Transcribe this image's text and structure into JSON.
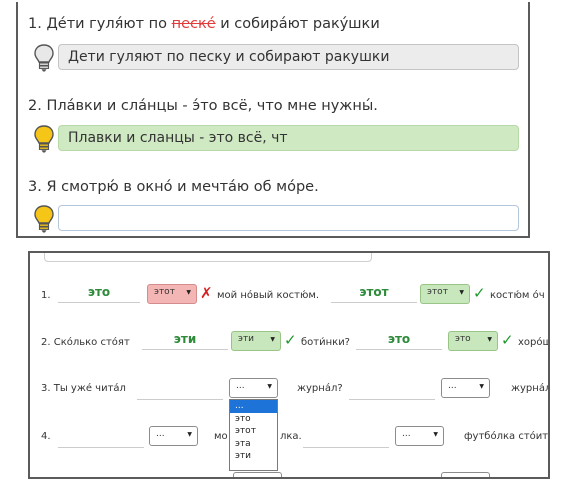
{
  "exercise1": {
    "items": [
      {
        "prefix": "1. Дéти гуля́ют по ",
        "error_word": "пескé",
        "suffix": " и собирáют раку́шки",
        "answer": "Дети гуляют по песку и собирают ракушки",
        "state": "neutral",
        "bulb_icon": "lightbulb-off-icon"
      },
      {
        "prefix": "2. Плáвки и слáнцы - э́то всё, что мне нужны́.",
        "error_word": "",
        "suffix": "",
        "answer": "Плавки и сланцы - это всё, чт",
        "state": "correct",
        "bulb_icon": "lightbulb-on-icon"
      },
      {
        "prefix": "3. Я смотрю́ в окнó и мечтáю об мóре.",
        "error_word": "",
        "suffix": "",
        "answer": "",
        "state": "empty",
        "bulb_icon": "lightbulb-on-icon"
      }
    ],
    "colors": {
      "error": "#e23b3b",
      "correct_bg": "#cfe9c2",
      "neutral_bg": "#ececec"
    }
  },
  "exercise2": {
    "row1": {
      "num": "1.",
      "word1": "это",
      "select1": "этот",
      "mark1": "✗",
      "text1": "мой нóвый костю́м.",
      "word2": "этот",
      "select2": "этот",
      "mark2": "✓",
      "text2": "костю́м óч"
    },
    "row2": {
      "num": "2. Скóлько стóят",
      "word1": "эти",
      "select1": "эти",
      "mark1": "✓",
      "text1": "боти́нки?",
      "word2": "это",
      "select2": "это",
      "mark2": "✓",
      "text2": "хорóш"
    },
    "row3": {
      "num": "3. Ты ужé читáл",
      "select1": "...",
      "text1": "журнáл?",
      "select2": "...",
      "text2": "журнáл"
    },
    "row4": {
      "num": "4.",
      "select1": "...",
      "text1": "мо",
      "text1b": "лка.",
      "select2": "...",
      "text2": "футбóлка стóит"
    },
    "dropdown": {
      "options": [
        "...",
        "это",
        "этот",
        "эта",
        "эти"
      ],
      "highlighted": "..."
    },
    "colors": {
      "word": "#2e8b3a",
      "wrong_bg": "#f4b5b5",
      "right_bg": "#c8e7bd",
      "highlight": "#1e73d8"
    }
  }
}
